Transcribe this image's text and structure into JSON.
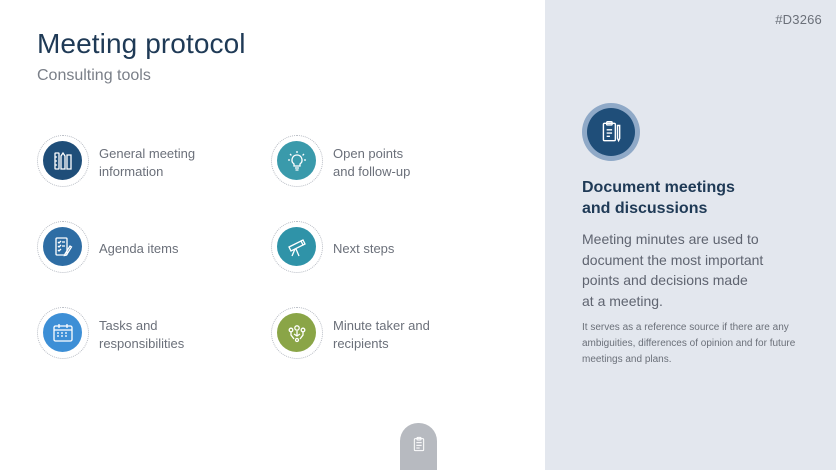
{
  "slide_id": "#D3266",
  "title": "Meeting protocol",
  "subtitle": "Consulting tools",
  "items": [
    {
      "label": "General meeting\ninformation",
      "icon": "pencils-ruler-icon",
      "color": "#1f4e79"
    },
    {
      "label": "Open points\nand follow-up",
      "icon": "lightbulb-icon",
      "color": "#3a9aab"
    },
    {
      "label": "Agenda items",
      "icon": "checklist-pen-icon",
      "color": "#2e6da4"
    },
    {
      "label": "Next steps",
      "icon": "telescope-icon",
      "color": "#2f93a8"
    },
    {
      "label": "Tasks and\nresponsibilities",
      "icon": "calendar-icon",
      "color": "#3d8fd6"
    },
    {
      "label": "Minute taker and\nrecipients",
      "icon": "people-network-icon",
      "color": "#8aa547"
    }
  ],
  "feature": {
    "icon": "clipboard-pen-icon",
    "heading": "Document meetings\nand discussions",
    "body": "Meeting minutes are used to\ndocument the most important\npoints and decisions made\nat a meeting.",
    "note": "It serves as a reference source if there are any ambiguities, differences of opinion and for future meetings and plans."
  },
  "colors": {
    "title": "#1f3a56",
    "panel": "#e3e7ee",
    "accent_navy": "#1f4e79"
  }
}
